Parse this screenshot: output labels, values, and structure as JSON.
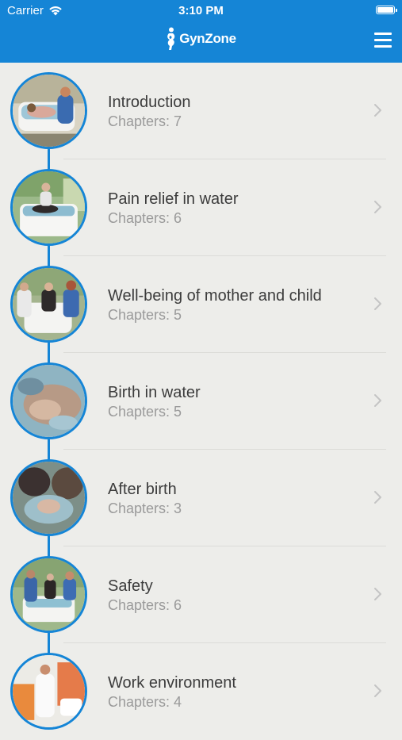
{
  "status_bar": {
    "carrier": "Carrier",
    "time": "3:10 PM",
    "battery_level": 1.0
  },
  "header": {
    "logo_text": "GynZone",
    "logo_icon": "gynzone-figure-icon",
    "menu_icon": "hamburger-menu-icon",
    "background_color": "#1585d6"
  },
  "lessons": [
    {
      "title": "Introduction",
      "chapters": "Chapters: 7"
    },
    {
      "title": "Pain relief in water",
      "chapters": "Chapters: 6"
    },
    {
      "title": "Well-being of mother and child",
      "chapters": "Chapters: 5"
    },
    {
      "title": "Birth in water",
      "chapters": "Chapters: 5"
    },
    {
      "title": "After birth",
      "chapters": "Chapters: 3"
    },
    {
      "title": "Safety",
      "chapters": "Chapters: 6"
    },
    {
      "title": "Work environment",
      "chapters": "Chapters: 4"
    }
  ],
  "colors": {
    "accent": "#1585d6",
    "background": "#ededea",
    "title_text": "#3c3c3c",
    "subtitle_text": "#9a9a9a"
  }
}
